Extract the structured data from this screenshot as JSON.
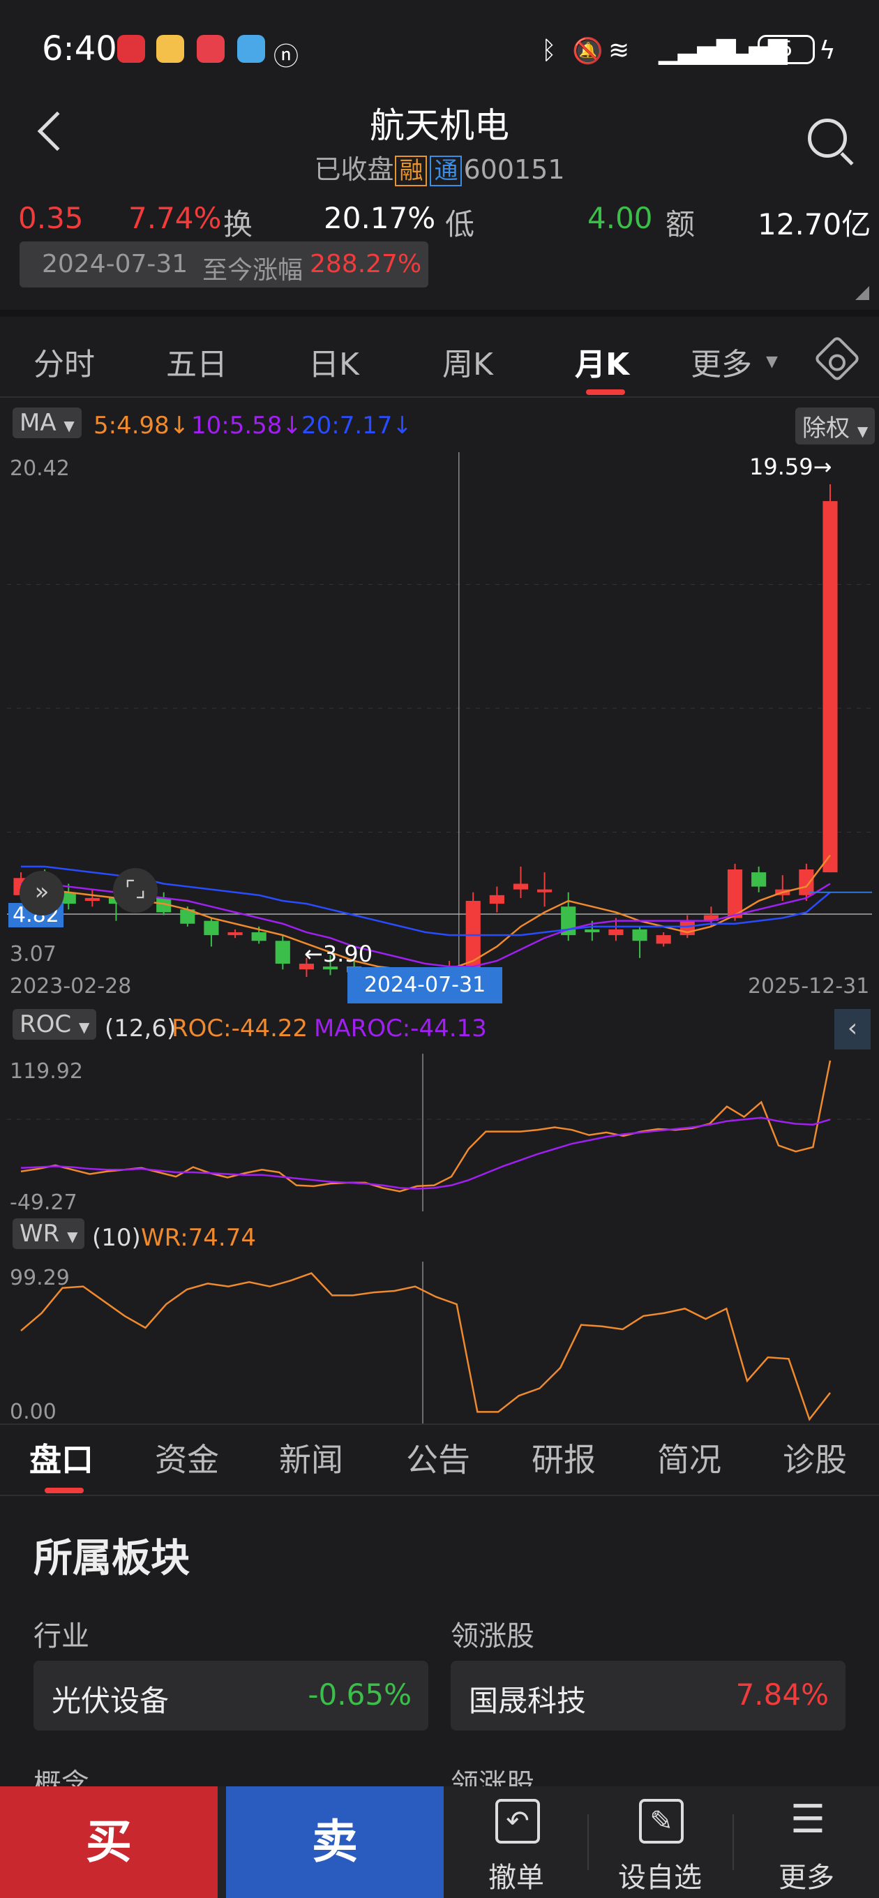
{
  "status_bar": {
    "time": "6:40",
    "battery": "5"
  },
  "header": {
    "title": "航天机电",
    "state": "已收盘",
    "tag_rong": "融",
    "tag_tong": "通",
    "code": "600151"
  },
  "quote": {
    "change": "0.35",
    "change_pct": "7.74%",
    "turnover_label": "换",
    "turnover": "20.17%",
    "low_label": "低",
    "low": "4.00",
    "amount_label": "额",
    "amount": "12.70亿",
    "range_date": "2024-07-31",
    "range_label": "至今涨幅",
    "range_pct": "288.27%"
  },
  "period_tabs": [
    {
      "label": "分时"
    },
    {
      "label": "五日"
    },
    {
      "label": "日K"
    },
    {
      "label": "周K"
    },
    {
      "label": "月K",
      "active": true
    },
    {
      "label": "更多"
    }
  ],
  "ma_row": {
    "chip": "MA",
    "ma5": "5:4.98↓",
    "ma10": "10:5.58↓",
    "ma20": "20:7.17↓",
    "adjust": "除权"
  },
  "main_chart_labels": {
    "top": "20.42",
    "bottom": "3.07",
    "high": "19.59→",
    "low": "←3.90",
    "current": "4.82",
    "date_left": "2023-02-28",
    "date_cursor": "2024-07-31",
    "date_right": "2025-12-31"
  },
  "roc_row": {
    "chip": "ROC",
    "params": "(12,6)",
    "roc": "ROC:-44.22",
    "maroc": "MAROC:-44.13",
    "top": "119.92",
    "bottom": "-49.27"
  },
  "wr_row": {
    "chip": "WR",
    "params": "(10)",
    "wr": "WR:74.74",
    "top": "99.29",
    "bottom": "0.00"
  },
  "bottom_tabs": [
    {
      "label": "盘口",
      "active": true
    },
    {
      "label": "资金"
    },
    {
      "label": "新闻"
    },
    {
      "label": "公告"
    },
    {
      "label": "研报"
    },
    {
      "label": "简况"
    },
    {
      "label": "诊股"
    }
  ],
  "sector": {
    "title": "所属板块",
    "industry_label": "行业",
    "leader_label": "领涨股",
    "industry_name": "光伏设备",
    "industry_pct": "-0.65%",
    "leader_name": "国晟科技",
    "leader_pct": "7.84%",
    "concept_label": "概念",
    "leader_label2": "领涨股"
  },
  "action_bar": {
    "buy": "买",
    "sell": "卖",
    "cancel": "撤单",
    "watch": "设自选",
    "more": "更多"
  },
  "colors": {
    "up": "#f23b3b",
    "down": "#3cbf4a",
    "ma5": "#f08a2e",
    "ma10": "#a020f0",
    "ma20": "#2a4cff",
    "accent": "#2f78d8"
  },
  "chart_data": [
    {
      "type": "candlestick",
      "title": "",
      "x_range": [
        "2023-02-28",
        "2025-12-31"
      ],
      "ylim": [
        3.07,
        20.42
      ],
      "candles": [
        {
          "o": 5.2,
          "c": 5.8,
          "h": 6.0,
          "l": 5.1
        },
        {
          "o": 5.8,
          "c": 5.2,
          "h": 6.1,
          "l": 5.0
        },
        {
          "o": 5.3,
          "c": 4.9,
          "h": 5.6,
          "l": 4.7
        },
        {
          "o": 5.0,
          "c": 5.1,
          "h": 5.4,
          "l": 4.8
        },
        {
          "o": 5.1,
          "c": 4.9,
          "h": 5.7,
          "l": 4.3
        },
        {
          "o": 5.0,
          "c": 5.1,
          "h": 5.3,
          "l": 4.9
        },
        {
          "o": 5.1,
          "c": 4.6,
          "h": 5.3,
          "l": 4.5
        },
        {
          "o": 4.7,
          "c": 4.2,
          "h": 4.8,
          "l": 4.1
        },
        {
          "o": 4.3,
          "c": 3.8,
          "h": 4.4,
          "l": 3.4
        },
        {
          "o": 3.8,
          "c": 3.9,
          "h": 4.0,
          "l": 3.7
        },
        {
          "o": 3.9,
          "c": 3.6,
          "h": 4.1,
          "l": 3.5
        },
        {
          "o": 3.6,
          "c": 2.8,
          "h": 3.8,
          "l": 2.6
        },
        {
          "o": 2.6,
          "c": 2.8,
          "h": 3.0,
          "l": 1.2
        },
        {
          "o": 2.7,
          "c": 2.6,
          "h": 3.1,
          "l": 2.4
        },
        {
          "o": 2.7,
          "c": 2.5,
          "h": 2.9,
          "l": 2.3
        },
        {
          "o": 2.5,
          "c": 2.4,
          "h": 2.7,
          "l": 2.1
        },
        {
          "o": 2.4,
          "c": 2.1,
          "h": 2.6,
          "l": 2.0
        },
        {
          "o": 2.0,
          "c": 2.3,
          "h": 2.5,
          "l": 1.8
        },
        {
          "o": 2.3,
          "c": 2.4,
          "h": 2.9,
          "l": 2.2
        },
        {
          "o": 2.6,
          "c": 5.0,
          "h": 5.3,
          "l": 2.5
        },
        {
          "o": 4.9,
          "c": 5.2,
          "h": 5.5,
          "l": 4.6
        },
        {
          "o": 5.4,
          "c": 5.6,
          "h": 6.2,
          "l": 5.1
        },
        {
          "o": 5.3,
          "c": 5.4,
          "h": 6.0,
          "l": 4.8
        },
        {
          "o": 4.8,
          "c": 3.8,
          "h": 5.3,
          "l": 3.6
        },
        {
          "o": 4.0,
          "c": 3.9,
          "h": 4.3,
          "l": 3.6
        },
        {
          "o": 3.8,
          "c": 4.0,
          "h": 4.4,
          "l": 3.6
        },
        {
          "o": 4.0,
          "c": 3.6,
          "h": 4.1,
          "l": 3.0
        },
        {
          "o": 3.5,
          "c": 3.8,
          "h": 3.9,
          "l": 3.4
        },
        {
          "o": 3.8,
          "c": 4.3,
          "h": 4.5,
          "l": 3.7
        },
        {
          "o": 4.3,
          "c": 4.5,
          "h": 4.8,
          "l": 4.1
        },
        {
          "o": 4.4,
          "c": 6.1,
          "h": 6.3,
          "l": 4.3
        },
        {
          "o": 6.0,
          "c": 5.5,
          "h": 6.2,
          "l": 5.3
        },
        {
          "o": 5.2,
          "c": 5.4,
          "h": 5.9,
          "l": 5.0
        },
        {
          "o": 5.2,
          "c": 6.1,
          "h": 6.3,
          "l": 5.0
        },
        {
          "o": 6.0,
          "c": 19.0,
          "h": 19.59,
          "l": 6.0
        }
      ],
      "ma5": [
        5.4,
        5.4,
        5.3,
        5.2,
        5.1,
        5.0,
        4.9,
        4.7,
        4.4,
        4.2,
        4.0,
        3.8,
        3.5,
        3.2,
        2.9,
        2.7,
        2.6,
        2.5,
        2.6,
        2.9,
        3.4,
        4.1,
        4.6,
        5.0,
        4.8,
        4.6,
        4.3,
        4.1,
        3.9,
        4.1,
        4.5,
        5.0,
        5.3,
        5.5,
        6.6
      ],
      "ma10": [
        5.6,
        5.6,
        5.5,
        5.4,
        5.3,
        5.2,
        5.1,
        5.0,
        4.8,
        4.6,
        4.4,
        4.2,
        3.9,
        3.7,
        3.4,
        3.2,
        3.0,
        2.8,
        2.7,
        2.7,
        2.9,
        3.3,
        3.7,
        4.0,
        4.2,
        4.3,
        4.3,
        4.3,
        4.3,
        4.3,
        4.5,
        4.7,
        4.9,
        5.1,
        5.6
      ],
      "ma20": [
        6.2,
        6.2,
        6.1,
        6.0,
        5.9,
        5.8,
        5.6,
        5.5,
        5.4,
        5.3,
        5.2,
        5.0,
        4.9,
        4.7,
        4.5,
        4.3,
        4.1,
        3.9,
        3.8,
        3.8,
        3.8,
        3.8,
        3.9,
        4.0,
        4.1,
        4.1,
        4.1,
        4.1,
        4.1,
        4.2,
        4.2,
        4.3,
        4.4,
        4.6,
        5.3
      ]
    },
    {
      "type": "line",
      "title": "ROC",
      "ylim": [
        -49.27,
        119.92
      ],
      "series": [
        {
          "name": "ROC",
          "values": [
            -8,
            -5,
            -1,
            -6,
            -11,
            -8,
            -6,
            -4,
            -9,
            -14,
            -3,
            -10,
            -15,
            -10,
            -6,
            -9,
            -24,
            -25,
            -22,
            -21,
            -21,
            -27,
            -31,
            -25,
            -24,
            -14,
            18,
            38,
            38,
            38,
            40,
            43,
            40,
            34,
            37,
            33,
            38,
            41,
            40,
            42,
            47,
            67,
            55,
            72,
            22,
            15,
            20,
            120
          ]
        },
        {
          "name": "MAROC",
          "values": [
            -4,
            -3,
            -2,
            -3,
            -5,
            -6,
            -6,
            -5,
            -7,
            -9,
            -9,
            -10,
            -11,
            -12,
            -12,
            -14,
            -16,
            -18,
            -20,
            -21,
            -22,
            -24,
            -27,
            -28,
            -27,
            -24,
            -18,
            -10,
            -2,
            5,
            12,
            18,
            24,
            28,
            32,
            35,
            37,
            39,
            41,
            43,
            46,
            50,
            52,
            54,
            50,
            47,
            46,
            52
          ]
        }
      ]
    },
    {
      "type": "line",
      "title": "WR",
      "ylim": [
        0.0,
        99.29
      ],
      "series": [
        {
          "name": "WR",
          "values": [
            60,
            72,
            89,
            90,
            80,
            70,
            62,
            78,
            88,
            92,
            90,
            93,
            90,
            94,
            99,
            84,
            84,
            86,
            87,
            90,
            83,
            78,
            5,
            5,
            16,
            21,
            35,
            64,
            63,
            61,
            70,
            72,
            75,
            68,
            75,
            26,
            42,
            41,
            0,
            18
          ]
        }
      ]
    }
  ]
}
